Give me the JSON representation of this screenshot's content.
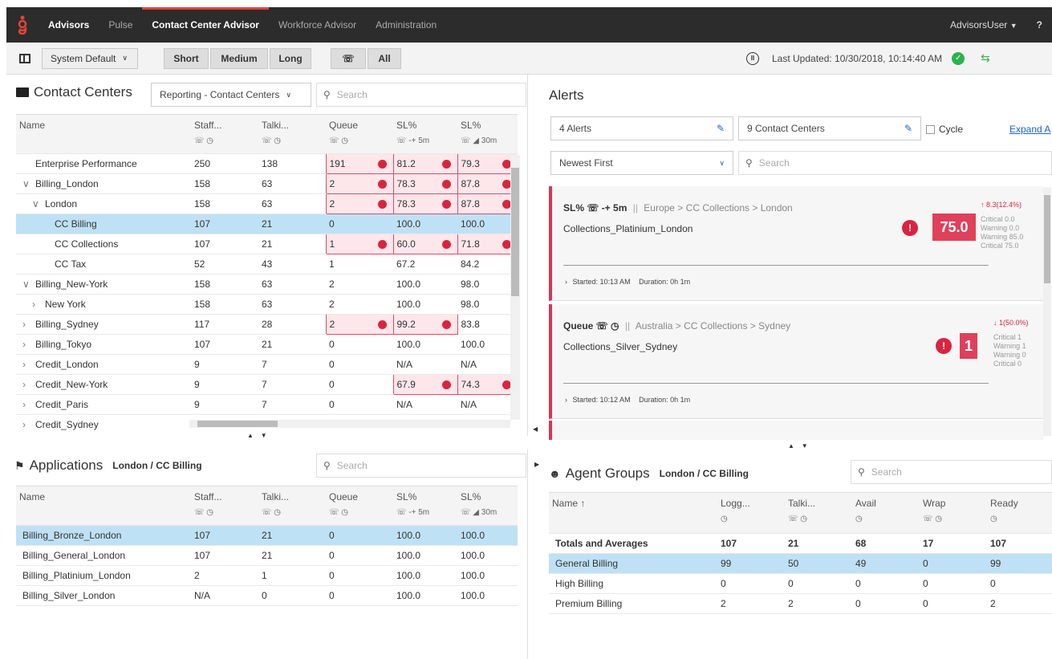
{
  "nav": {
    "items": [
      {
        "label": "Advisors"
      },
      {
        "label": "Pulse"
      },
      {
        "label": "Contact Center Advisor"
      },
      {
        "label": "Workforce Advisor"
      },
      {
        "label": "Administration"
      }
    ],
    "user": "AdvisorsUser",
    "help": "?"
  },
  "toolbar": {
    "layout": "System Default",
    "short": "Short",
    "medium": "Medium",
    "long": "Long",
    "all": "All",
    "last_updated": "Last Updated: 10/30/2018, 10:14:40 AM"
  },
  "cc": {
    "title": "Contact Centers",
    "grouping": "Reporting - Contact Centers",
    "search": "Search",
    "columns": [
      {
        "label": "Name",
        "sub": ""
      },
      {
        "label": "Staff...",
        "sub": "☏ ◷"
      },
      {
        "label": "Talki...",
        "sub": "☏ ◷"
      },
      {
        "label": "Queue",
        "sub": "☏ ◷"
      },
      {
        "label": "SL%",
        "sub": "☏ -+ 5m"
      },
      {
        "label": "SL%",
        "sub": "☏ ◢ 30m"
      }
    ],
    "rows": [
      {
        "indent": 0,
        "chev": "",
        "name": "Enterprise Performance",
        "staff": "250",
        "talk": "138",
        "queue": "191",
        "sl5": "81.2",
        "sl30": "79.3"
      },
      {
        "indent": 0,
        "chev": "∨",
        "name": "Billing_London",
        "staff": "158",
        "talk": "63",
        "queue": "2",
        "sl5": "78.3",
        "sl30": "87.8"
      },
      {
        "indent": 1,
        "chev": "∨",
        "name": "London",
        "staff": "158",
        "talk": "63",
        "queue": "2",
        "sl5": "78.3",
        "sl30": "87.8"
      },
      {
        "indent": 2,
        "chev": "",
        "name": "CC Billing",
        "staff": "107",
        "talk": "21",
        "queue": "0",
        "sl5": "100.0",
        "sl30": "100.0"
      },
      {
        "indent": 2,
        "chev": "",
        "name": "CC Collections",
        "staff": "107",
        "talk": "21",
        "queue": "1",
        "sl5": "60.0",
        "sl30": "71.8"
      },
      {
        "indent": 2,
        "chev": "",
        "name": "CC Tax",
        "staff": "52",
        "talk": "43",
        "queue": "1",
        "sl5": "67.2",
        "sl30": "84.2"
      },
      {
        "indent": 0,
        "chev": "∨",
        "name": "Billing_New-York",
        "staff": "158",
        "talk": "63",
        "queue": "2",
        "sl5": "100.0",
        "sl30": "98.0"
      },
      {
        "indent": 1,
        "chev": "›",
        "name": "New York",
        "staff": "158",
        "talk": "63",
        "queue": "2",
        "sl5": "100.0",
        "sl30": "98.0"
      },
      {
        "indent": 0,
        "chev": "›",
        "name": "Billing_Sydney",
        "staff": "117",
        "talk": "28",
        "queue": "2",
        "sl5": "99.2",
        "sl30": "83.8"
      },
      {
        "indent": 0,
        "chev": "›",
        "name": "Billing_Tokyo",
        "staff": "107",
        "talk": "21",
        "queue": "0",
        "sl5": "100.0",
        "sl30": "100.0"
      },
      {
        "indent": 0,
        "chev": "›",
        "name": "Credit_London",
        "staff": "9",
        "talk": "7",
        "queue": "0",
        "sl5": "N/A",
        "sl30": "N/A"
      },
      {
        "indent": 0,
        "chev": "›",
        "name": "Credit_New-York",
        "staff": "9",
        "talk": "7",
        "queue": "0",
        "sl5": "67.9",
        "sl30": "74.3"
      },
      {
        "indent": 0,
        "chev": "›",
        "name": "Credit_Paris",
        "staff": "9",
        "talk": "7",
        "queue": "0",
        "sl5": "N/A",
        "sl30": "N/A"
      },
      {
        "indent": 0,
        "chev": "›",
        "name": "Credit_Sydney",
        "staff": "",
        "talk": "",
        "queue": "",
        "sl5": "",
        "sl30": ""
      }
    ]
  },
  "apps": {
    "title": "Applications",
    "context": "London / CC Billing",
    "search": "Search",
    "rows": [
      {
        "name": "Billing_Bronze_London",
        "staff": "107",
        "talk": "21",
        "queue": "0",
        "sl5": "100.0",
        "sl30": "100.0"
      },
      {
        "name": "Billing_General_London",
        "staff": "107",
        "talk": "21",
        "queue": "0",
        "sl5": "100.0",
        "sl30": "100.0"
      },
      {
        "name": "Billing_Platinium_London",
        "staff": "2",
        "talk": "1",
        "queue": "0",
        "sl5": "100.0",
        "sl30": "100.0"
      },
      {
        "name": "Billing_Silver_London",
        "staff": "N/A",
        "talk": "0",
        "queue": "0",
        "sl5": "100.0",
        "sl30": "100.0"
      }
    ]
  },
  "alerts": {
    "title": "Alerts",
    "count": "4 Alerts",
    "centers": "9 Contact Centers",
    "cycle": "Cycle",
    "expand": "Expand A",
    "sort": "Newest First",
    "search": "Search",
    "cards": [
      {
        "metric": "SL% ☏ -+ 5m",
        "path": "Europe > CC Collections > London",
        "name": "Collections_Platinium_London",
        "value": "75.0",
        "trend": "↑ 8.3(12.4%)",
        "thresholds": [
          "Critical 0.0",
          "Warning 0.0",
          "Warning 85.0",
          "Critical 75.0"
        ],
        "started": "Started: 10:13 AM",
        "duration": "Duration: 0h 1m"
      },
      {
        "metric": "Queue ☏ ◷",
        "path": "Australia > CC Collections > Sydney",
        "name": "Collections_Silver_Sydney",
        "value": "1",
        "trend": "↓ 1(50.0%)",
        "thresholds": [
          "Critical 1",
          "Warning 1",
          "Warning 0",
          "Critical 0"
        ],
        "started": "Started: 10:12 AM",
        "duration": "Duration: 0h 1m"
      }
    ]
  },
  "agents": {
    "title": "Agent Groups",
    "context": "London / CC Billing",
    "search": "Search",
    "columns": [
      {
        "label": "Name ↑",
        "sub": ""
      },
      {
        "label": "Logg...",
        "sub": "◷"
      },
      {
        "label": "Talki...",
        "sub": "☏ ◷"
      },
      {
        "label": "Avail",
        "sub": "◷"
      },
      {
        "label": "Wrap",
        "sub": "☏ ◷"
      },
      {
        "label": "Ready",
        "sub": "◷"
      }
    ],
    "rows": [
      {
        "name": "Totals and Averages",
        "logged": "107",
        "talk": "21",
        "avail": "68",
        "wrap": "17",
        "ready": "107"
      },
      {
        "name": "General Billing",
        "logged": "99",
        "talk": "50",
        "avail": "49",
        "wrap": "0",
        "ready": "99"
      },
      {
        "name": "High Billing",
        "logged": "0",
        "talk": "0",
        "avail": "0",
        "wrap": "0",
        "ready": "0"
      },
      {
        "name": "Premium Billing",
        "logged": "2",
        "talk": "2",
        "avail": "0",
        "wrap": "0",
        "ready": "2"
      }
    ]
  }
}
